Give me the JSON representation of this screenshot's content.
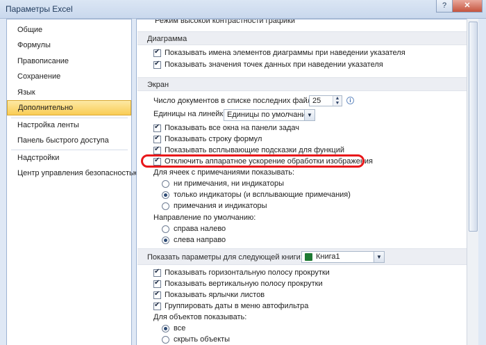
{
  "window": {
    "title": "Параметры Excel",
    "help": "?",
    "close": "✕"
  },
  "sidebar": {
    "items": [
      {
        "label": "Общие"
      },
      {
        "label": "Формулы"
      },
      {
        "label": "Правописание"
      },
      {
        "label": "Сохранение"
      },
      {
        "label": "Язык"
      },
      {
        "label": "Дополнительно",
        "active": true
      },
      {
        "label": "Настройка ленты"
      },
      {
        "label": "Панель быстрого доступа"
      },
      {
        "label": "Надстройки"
      },
      {
        "label": "Центр управления безопасностью"
      }
    ]
  },
  "content": {
    "cut_row": "Режим высокой контрастности графики",
    "diagram": {
      "title": "Диаграмма",
      "options": [
        {
          "label": "Показывать имена элементов диаграммы при наведении указателя",
          "checked": true
        },
        {
          "label": "Показывать значения точек данных при наведении указателя",
          "checked": true
        }
      ]
    },
    "screen": {
      "title": "Экран",
      "recent_files_label": "Число документов в списке последних файлов:",
      "recent_files_value": "25",
      "ruler_label": "Единицы на линейке",
      "ruler_value": "Единицы по умолчанию",
      "options": [
        {
          "label": "Показывать все окна на панели задач",
          "checked": true
        },
        {
          "label": "Показывать строку формул",
          "checked": true
        },
        {
          "label": "Показывать всплывающие подсказки для функций",
          "checked": true
        },
        {
          "label": "Отключить аппаратное ускорение обработки изображения",
          "checked": true,
          "highlighted": true
        }
      ],
      "comments_label": "Для ячеек с примечаниями показывать:",
      "comments_options": [
        {
          "label": "ни примечания, ни индикаторы",
          "checked": false
        },
        {
          "label": "только индикаторы (и всплывающие примечания)",
          "checked": true
        },
        {
          "label": "примечания и индикаторы",
          "checked": false
        }
      ],
      "direction_label": "Направление по умолчанию:",
      "direction_options": [
        {
          "label": "справа налево",
          "checked": false
        },
        {
          "label": "слева направо",
          "checked": true
        }
      ]
    },
    "workbook": {
      "title": "Показать параметры для следующей книги:",
      "book": "Книга1",
      "options": [
        {
          "label": "Показывать горизонтальную полосу прокрутки",
          "checked": true
        },
        {
          "label": "Показывать вертикальную полосу прокрутки",
          "checked": true
        },
        {
          "label": "Показывать ярлычки листов",
          "checked": true
        },
        {
          "label": "Группировать даты в меню автофильтра",
          "checked": true
        }
      ],
      "objects_label": "Для объектов показывать:",
      "objects_options": [
        {
          "label": "все",
          "checked": true
        },
        {
          "label": "скрыть объекты",
          "checked": false
        }
      ]
    }
  },
  "colors": {
    "highlight": "#e8171a",
    "active_item": "#f9cc55"
  }
}
